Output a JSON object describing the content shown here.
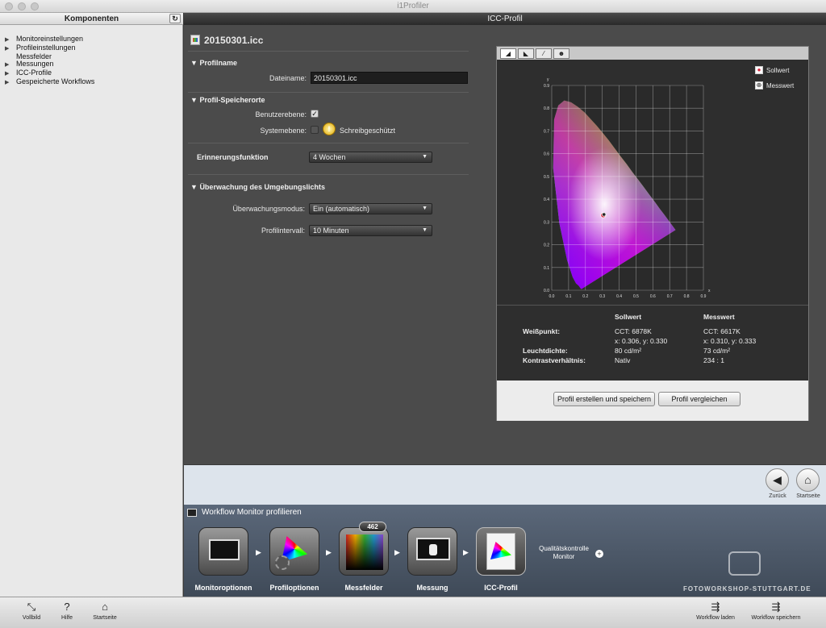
{
  "window": {
    "title": "i1Profiler"
  },
  "sidebar": {
    "title": "Komponenten",
    "items": [
      {
        "label": "Monitoreinstellungen",
        "expandable": true
      },
      {
        "label": "Profileinstellungen",
        "expandable": true
      },
      {
        "label": "Messfelder",
        "expandable": false
      },
      {
        "label": "Messungen",
        "expandable": true
      },
      {
        "label": "ICC-Profile",
        "expandable": true
      },
      {
        "label": "Gespeicherte Workflows",
        "expandable": true
      }
    ]
  },
  "main": {
    "title": "ICC-Profil",
    "file_name": "20150301.icc",
    "profilname": {
      "heading": "Profilname",
      "dateiname_label": "Dateiname:",
      "dateiname_value": "20150301.icc"
    },
    "speicherorte": {
      "heading": "Profil-Speicherorte",
      "benutzer_label": "Benutzerebene:",
      "benutzer_checked": true,
      "system_label": "Systemebene:",
      "system_checked": false,
      "schreib_label": "Schreibgeschützt"
    },
    "erinnerung": {
      "label": "Erinnerungsfunktion",
      "value": "4 Wochen"
    },
    "umgebung": {
      "heading": "Überwachung des Umgebungslichts",
      "modus_label": "Überwachungsmodus:",
      "modus_value": "Ein (automatisch)",
      "intervall_label": "Profilintervall:",
      "intervall_value": "10 Minuten"
    }
  },
  "graph": {
    "legend_soll": "Sollwert",
    "legend_mess": "Messwert",
    "stats": {
      "col_soll": "Sollwert",
      "col_mess": "Messwert",
      "weiss_label": "Weißpunkt:",
      "soll_cct": "CCT: 6878K",
      "mess_cct": "CCT: 6617K",
      "soll_xy": "x: 0.306, y: 0.330",
      "mess_xy": "x: 0.310, y: 0.333",
      "leucht_label": "Leuchtdichte:",
      "soll_leucht": "80 cd/m²",
      "mess_leucht": "73 cd/m²",
      "kontrast_label": "Kontrastverhältnis:",
      "soll_kontrast": "Nativ",
      "mess_kontrast": "234 : 1"
    },
    "btn_create": "Profil erstellen und speichern",
    "btn_compare": "Profil vergleichen"
  },
  "chart_data": {
    "type": "scatter",
    "xlabel": "x",
    "ylabel": "y",
    "xlim": [
      0.0,
      0.9
    ],
    "ylim": [
      0.0,
      0.9
    ],
    "xticks": [
      "0.0",
      "0.1",
      "0.2",
      "0.3",
      "0.4",
      "0.5",
      "0.6",
      "0.7",
      "0.8",
      "0.9"
    ],
    "yticks": [
      "0.0",
      "0.1",
      "0.2",
      "0.3",
      "0.4",
      "0.5",
      "0.6",
      "0.7",
      "0.8",
      "0.9"
    ],
    "series": [
      {
        "name": "Sollwert",
        "x": [
          0.306
        ],
        "y": [
          0.33
        ]
      },
      {
        "name": "Messwert",
        "x": [
          0.31
        ],
        "y": [
          0.333
        ]
      }
    ]
  },
  "nav": {
    "back_label": "Zurück",
    "home_label": "Startseite"
  },
  "workflow": {
    "title": "Workflow Monitor profilieren",
    "badge": "462",
    "steps": [
      "Monitoroptionen",
      "Profiloptionen",
      "Messfelder",
      "Messung",
      "ICC-Profil"
    ],
    "extra_label": "Qualitätskontrolle Monitor",
    "watermark": "FOTOWORKSHOP-STUTTGART.DE"
  },
  "toolbar": {
    "vollbild": "Vollbild",
    "hilfe": "Hilfe",
    "startseite": "Startseite",
    "wf_laden": "Workflow laden",
    "wf_speichern": "Workflow speichern"
  },
  "colors": {
    "accent_red": "#d7263d",
    "panel_dark": "#2e2e2e"
  }
}
